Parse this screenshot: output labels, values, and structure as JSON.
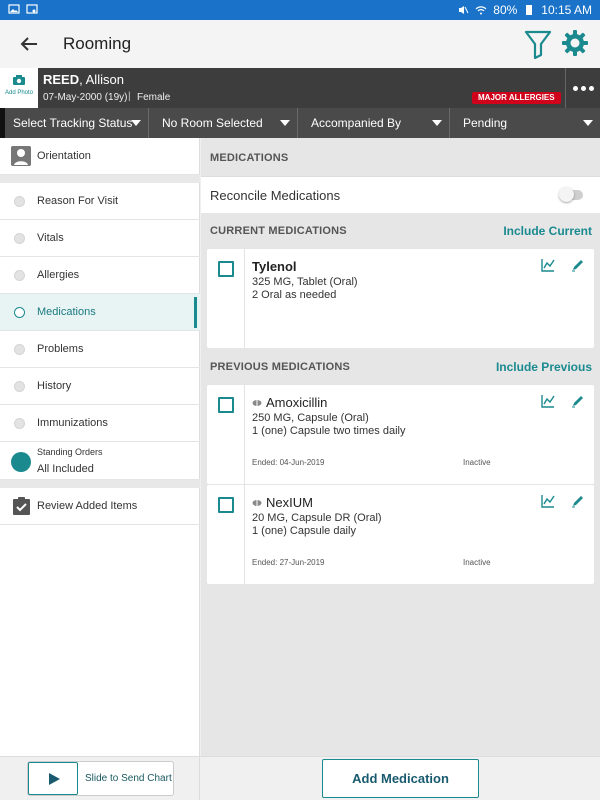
{
  "status_bar": {
    "battery": "80%",
    "time": "10:15 AM"
  },
  "app_bar": {
    "title": "Rooming"
  },
  "patient": {
    "add_photo_label": "Add Photo",
    "last_name": "REED",
    "first_name": ", Allison",
    "dob": "07-May-2000 (19y)",
    "separator": "|",
    "sex": "Female",
    "allergy_badge": "MAJOR ALLERGIES"
  },
  "dropdowns": [
    {
      "label": "Select Tracking Status"
    },
    {
      "label": "No Room Selected"
    },
    {
      "label": "Accompanied By"
    },
    {
      "label": "Pending"
    }
  ],
  "sidebar": {
    "orientation": "Orientation",
    "items": [
      {
        "label": "Reason For Visit"
      },
      {
        "label": "Vitals"
      },
      {
        "label": "Allergies"
      },
      {
        "label": "Medications"
      },
      {
        "label": "Problems"
      },
      {
        "label": "History"
      },
      {
        "label": "Immunizations"
      }
    ],
    "standing_orders_title": "Standing Orders",
    "standing_orders_value": "All Included",
    "review": "Review Added Items"
  },
  "main": {
    "section_title": "MEDICATIONS",
    "reconcile_label": "Reconcile Medications",
    "current_title": "CURRENT MEDICATIONS",
    "current_action": "Include Current",
    "previous_title": "PREVIOUS MEDICATIONS",
    "previous_action": "Include Previous",
    "current_meds": [
      {
        "name": "Tylenol",
        "dose": "325 MG, Tablet (Oral)",
        "sig": "2 Oral as needed"
      }
    ],
    "previous_meds": [
      {
        "name": "Amoxicillin",
        "dose": "250 MG, Capsule (Oral)",
        "sig": "1 (one) Capsule two times daily",
        "ended": "Ended: 04-Jun-2019",
        "status": "Inactive"
      },
      {
        "name": "NexIUM",
        "dose": "20 MG, Capsule DR (Oral)",
        "sig": "1 (one) Capsule daily",
        "ended": "Ended: 27-Jun-2019",
        "status": "Inactive"
      }
    ]
  },
  "bottom": {
    "slide_label": "Slide to Send Chart",
    "add_button": "Add Medication"
  },
  "colors": {
    "accent": "#1a8a8f",
    "status_bar": "#1a73c9",
    "allergy": "#d0021b"
  }
}
